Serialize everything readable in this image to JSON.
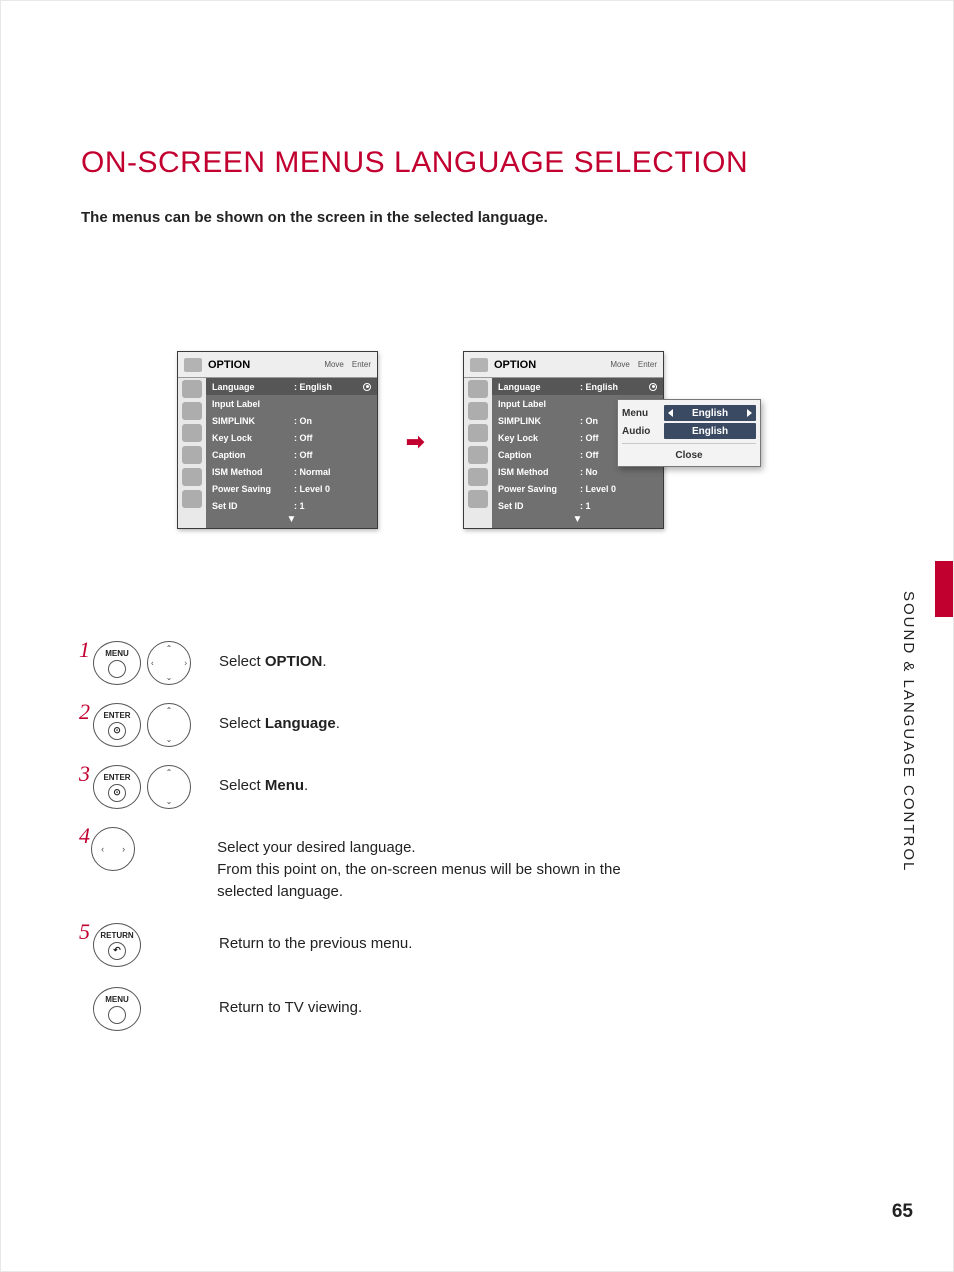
{
  "title": "ON-SCREEN MENUS LANGUAGE SELECTION",
  "subtitle": "The menus can be shown on the screen in the selected language.",
  "osd": {
    "header_title": "OPTION",
    "hint_move": "Move",
    "hint_enter": "Enter",
    "rows": [
      {
        "label": "Language",
        "value": ": English",
        "selected": true,
        "has_bullet": true
      },
      {
        "label": "Input Label",
        "value": ""
      },
      {
        "label": "SIMPLINK",
        "value": ": On"
      },
      {
        "label": "Key Lock",
        "value": ": Off"
      },
      {
        "label": "Caption",
        "value": ": Off"
      },
      {
        "label": "ISM Method",
        "value": ": Normal"
      },
      {
        "label": "Power Saving",
        "value": ": Level 0"
      },
      {
        "label": "Set ID",
        "value": ": 1"
      }
    ],
    "rows_right": [
      {
        "label": "Language",
        "value": ": English",
        "selected": true,
        "has_bullet": true
      },
      {
        "label": "Input Label",
        "value": ""
      },
      {
        "label": "SIMPLINK",
        "value": ": On"
      },
      {
        "label": "Key Lock",
        "value": ": Off"
      },
      {
        "label": "Caption",
        "value": ": Off"
      },
      {
        "label": "ISM Method",
        "value": ": No"
      },
      {
        "label": "Power Saving",
        "value": ": Level 0"
      },
      {
        "label": "Set ID",
        "value": ": 1"
      }
    ]
  },
  "popup": {
    "row1_label": "Menu",
    "row1_value": "English",
    "row2_label": "Audio",
    "row2_value": "English",
    "close": "Close"
  },
  "arrow": "➡",
  "steps": [
    {
      "num": "1",
      "button": "MENU",
      "pad": "full",
      "text_prefix": "Select ",
      "text_bold": "OPTION",
      "text_suffix": "."
    },
    {
      "num": "2",
      "button": "ENTER",
      "pad": "updown",
      "text_prefix": "Select ",
      "text_bold": "Language",
      "text_suffix": "."
    },
    {
      "num": "3",
      "button": "ENTER",
      "pad": "updown",
      "text_prefix": "Select ",
      "text_bold": "Menu",
      "text_suffix": "."
    },
    {
      "num": "4",
      "button": "",
      "pad": "leftright",
      "text_prefix": "",
      "text_bold": "",
      "text_suffix": "Select your desired language.\nFrom this point on, the on-screen menus will be shown in the selected language."
    },
    {
      "num": "5",
      "button": "RETURN",
      "pad": "",
      "text_prefix": "",
      "text_bold": "",
      "text_suffix": "Return to the previous menu."
    },
    {
      "num": "",
      "button": "MENU",
      "pad": "",
      "text_prefix": "",
      "text_bold": "",
      "text_suffix": "Return to TV viewing."
    }
  ],
  "side_label": "SOUND & LANGUAGE CONTROL",
  "page_number": "65"
}
